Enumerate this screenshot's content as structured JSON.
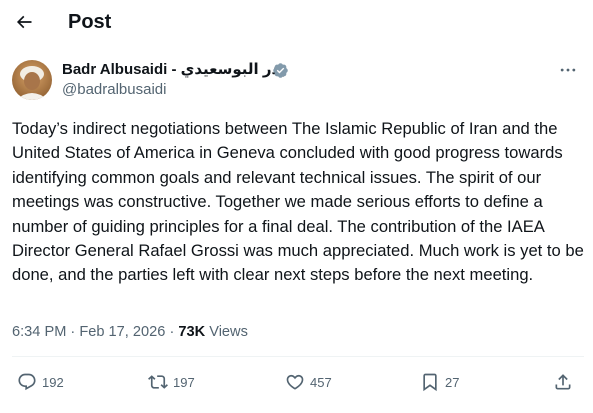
{
  "header": {
    "title": "Post"
  },
  "author": {
    "display_name": "Badr Albusaidi - بدر البوسعيدي",
    "handle": "@badralbusaidi",
    "verified": true
  },
  "tweet": {
    "text": "Today’s indirect negotiations between The Islamic Republic of Iran and the United States of America in Geneva concluded with good progress towards identifying common goals and relevant  technical issues. The spirit of our meetings was constructive. Together we made serious efforts to define a number of guiding principles for a final deal. The contribution of the IAEA Director General Rafael Grossi was much appreciated. Much work is yet to be done, and the parties left with clear next steps before the next meeting.",
    "time": "6:34 PM",
    "separator": "·",
    "date": "Feb 17, 2026",
    "views_count": "73K",
    "views_label": "Views"
  },
  "actions": {
    "replies": "192",
    "reposts": "197",
    "likes": "457",
    "bookmarks": "27"
  },
  "colors": {
    "text": "#0f1419",
    "secondary": "#536471",
    "verified": "#829aab",
    "divider": "#eff3f4"
  },
  "icons": [
    "back-arrow-icon",
    "verified-badge-icon",
    "more-icon",
    "reply-icon",
    "repost-icon",
    "like-icon",
    "bookmark-icon",
    "share-icon"
  ]
}
